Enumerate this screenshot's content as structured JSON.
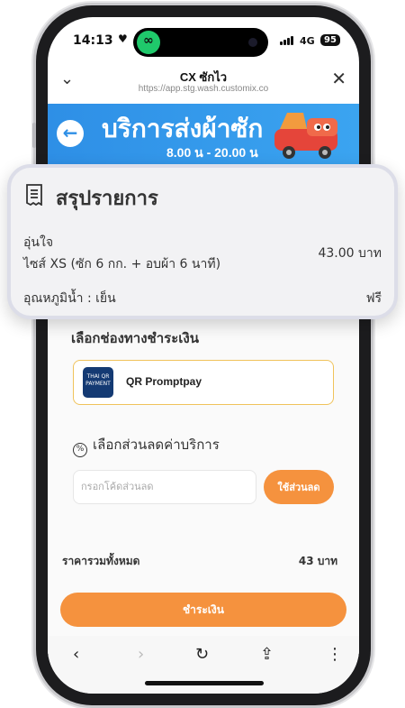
{
  "status_bar": {
    "time": "14:13",
    "network": "4G",
    "battery": "95"
  },
  "browser": {
    "title": "CX ซักไว",
    "url": "https://app.stg.wash.customix.co"
  },
  "banner": {
    "title": "บริการส่งผ้าซัก",
    "hours": "8.00 น - 20.00 น"
  },
  "summary": {
    "title": "สรุปรายการ",
    "item_name": "อุ่นใจ",
    "item_desc": "ไซส์ XS (ซัก 6 กก. + อบผ้า 6 นาที)",
    "item_price": "43.00 บาท",
    "temperature": "อุณหภูมิน้ำ : เย็น",
    "temperature_price": "ฟรี"
  },
  "payment": {
    "title": "เลือกช่องทางชำระเงิน",
    "method_label": "QR Promptpay",
    "logo_text": "THAI QR PAYMENT"
  },
  "discount": {
    "title": "เลือกส่วนลดค่าบริการ",
    "placeholder": "กรอกโค้ดส่วนลด",
    "apply_label": "ใช้ส่วนลด"
  },
  "total": {
    "label": "ราคารวมทั้งหมด",
    "value": "43 บาท"
  },
  "pay_button": "ชำระเงิน",
  "icons": {
    "back": "arrow-left-icon",
    "chevron": "chevron-down-icon",
    "close": "close-icon",
    "receipt": "receipt-icon"
  },
  "colors": {
    "accent": "#f5923e",
    "banner": "#2e8fe6"
  }
}
